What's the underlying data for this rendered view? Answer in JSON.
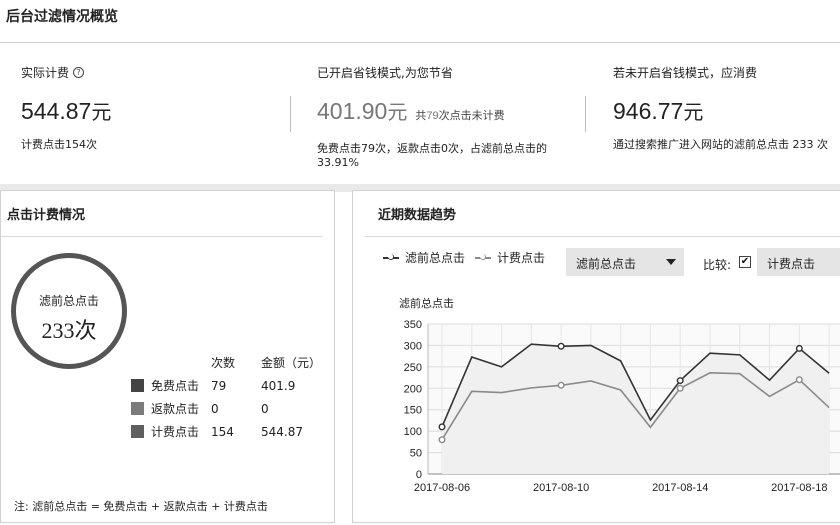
{
  "page_title": "后台过滤情况概览",
  "stats": {
    "actual": {
      "label": "实际计费",
      "amount": "544.87",
      "unit": "元",
      "sub": "计费点击154次"
    },
    "saving": {
      "label": "已开启省钱模式,为您节省",
      "amount": "401.90",
      "unit": "元",
      "note_prefix": "共",
      "note_count": "79",
      "note_suffix": "次点击未计费",
      "sub_line1": "免费点击79次，返款点击0次，占滤前总点击的",
      "sub_line2": "33.91%"
    },
    "without": {
      "label": "若未开启省钱模式，应消费",
      "amount": "946.77",
      "unit": "元",
      "sub": "通过搜索推广进入网站的滤前总点击 233 次"
    }
  },
  "click_panel": {
    "title": "点击计费情况",
    "ring_label": "滤前总点击",
    "ring_value": "233次",
    "col_count": "次数",
    "col_amount": "金额（元）",
    "rows": [
      {
        "name": "免费点击",
        "count": "79",
        "amount": "401.9",
        "color": "#444444"
      },
      {
        "name": "返款点击",
        "count": "0",
        "amount": "0",
        "color": "#7a7a7a"
      },
      {
        "name": "计费点击",
        "count": "154",
        "amount": "544.87",
        "color": "#5f5f5f"
      }
    ],
    "footnote": "注: 滤前总点击 = 免费点击 + 返款点击 + 计费点击"
  },
  "trend_panel": {
    "title": "近期数据趋势",
    "legend1": "滤前总点击",
    "legend2": "计费点击",
    "select1": "滤前总点击",
    "compare_label": "比较:",
    "compare_checked": "✔",
    "select2": "计费点击"
  },
  "chart_data": {
    "type": "line",
    "ylabel": "滤前总点击",
    "xlabel": "",
    "ylim": [
      0,
      350
    ],
    "yticks": [
      "0",
      "50",
      "100",
      "150",
      "200",
      "250",
      "300",
      "350"
    ],
    "x": [
      "2017-08-06",
      "2017-08-07",
      "2017-08-08",
      "2017-08-09",
      "2017-08-10",
      "2017-08-11",
      "2017-08-12",
      "2017-08-13",
      "2017-08-14",
      "2017-08-15",
      "2017-08-16",
      "2017-08-17",
      "2017-08-18",
      "2017-08-19"
    ],
    "xtick_labels": [
      "2017-08-06",
      "2017-08-10",
      "2017-08-14",
      "2017-08-18"
    ],
    "series": [
      {
        "name": "滤前总点击",
        "color": "#333333",
        "values": [
          110,
          273,
          250,
          303,
          298,
          300,
          264,
          126,
          218,
          282,
          278,
          219,
          293,
          235
        ]
      },
      {
        "name": "计费点击",
        "color": "#8a8a8a",
        "values": [
          80,
          193,
          190,
          201,
          207,
          217,
          196,
          109,
          200,
          236,
          234,
          181,
          220,
          155
        ]
      }
    ],
    "marked_index": [
      0,
      4,
      8,
      12
    ]
  }
}
